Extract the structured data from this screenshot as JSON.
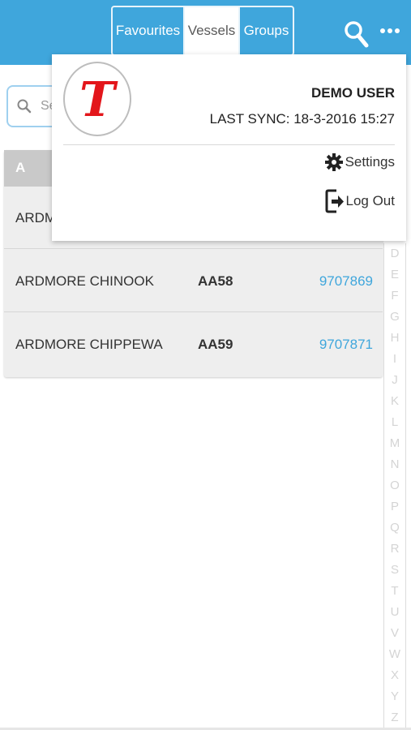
{
  "header": {
    "tabs": [
      {
        "label": "Favourites"
      },
      {
        "label": "Vessels"
      },
      {
        "label": "Groups"
      }
    ],
    "accent_color": "#3fa6dc"
  },
  "search": {
    "placeholder": "Se"
  },
  "list": {
    "section": "A",
    "rows": [
      {
        "name": "ARDM",
        "code": "",
        "imo": ""
      },
      {
        "name": "ARDMORE CHINOOK",
        "code": "AA58",
        "imo": "9707869"
      },
      {
        "name": "ARDMORE CHIPPEWA",
        "code": "AA59",
        "imo": "9707871"
      }
    ]
  },
  "alphabet": [
    "D",
    "E",
    "F",
    "G",
    "H",
    "I",
    "J",
    "K",
    "L",
    "M",
    "N",
    "O",
    "P",
    "Q",
    "R",
    "S",
    "T",
    "U",
    "V",
    "W",
    "X",
    "Y",
    "Z"
  ],
  "menu": {
    "user": "DEMO USER",
    "last_sync": "LAST SYNC: 18-3-2016 15:27",
    "settings_label": "Settings",
    "logout_label": "Log Out",
    "logo_letter": "T"
  }
}
